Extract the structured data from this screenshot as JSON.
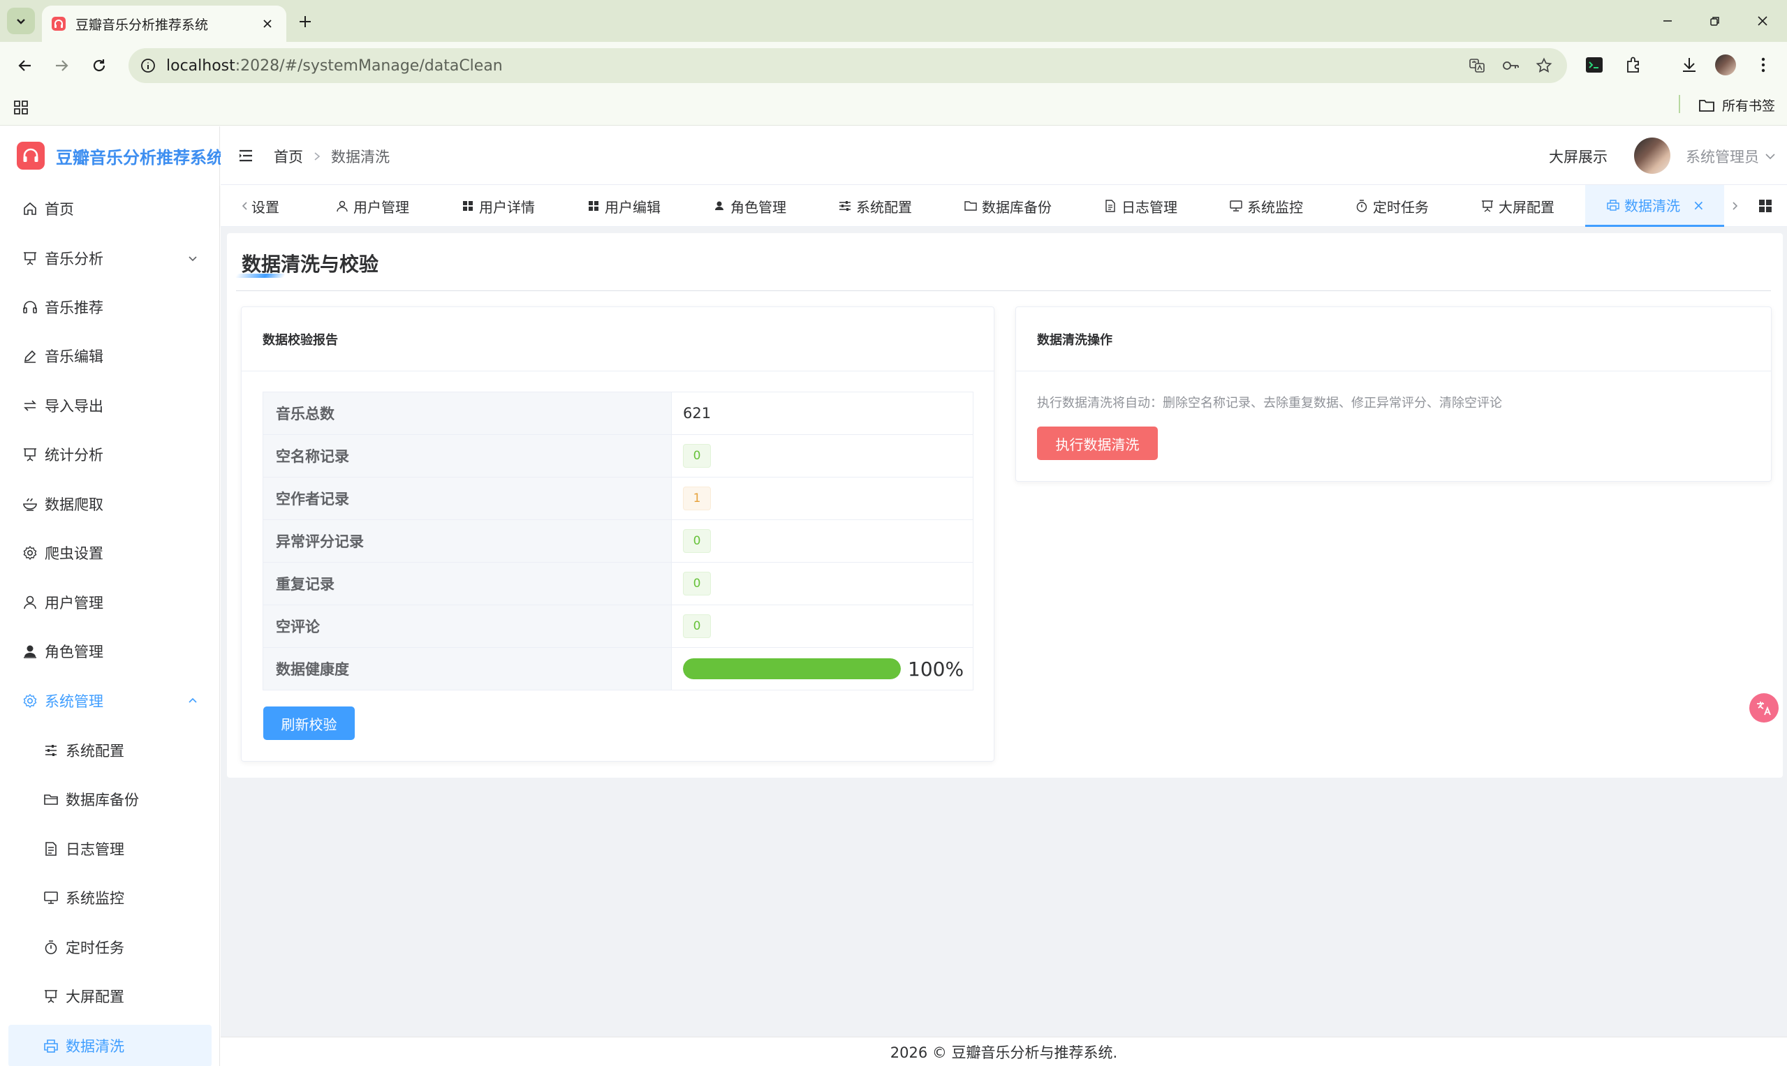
{
  "browser": {
    "tab_title": "豆瓣音乐分析推荐系统",
    "url_host": "localhost",
    "url_rest": ":2028/#/systemManage/dataClean",
    "bookmarks_all": "所有书签"
  },
  "sidebar": {
    "logo_text": "豆瓣音乐分析推荐系统",
    "items": [
      {
        "label": "首页",
        "icon": "home-icon"
      },
      {
        "label": "音乐分析",
        "icon": "presentation-icon"
      },
      {
        "label": "音乐推荐",
        "icon": "headphones-icon"
      },
      {
        "label": "音乐编辑",
        "icon": "edit-icon"
      },
      {
        "label": "导入导出",
        "icon": "swap-icon"
      },
      {
        "label": "统计分析",
        "icon": "presentation-icon"
      },
      {
        "label": "数据爬取",
        "icon": "bowl-icon"
      },
      {
        "label": "爬虫设置",
        "icon": "gear-icon"
      },
      {
        "label": "用户管理",
        "icon": "user-icon"
      },
      {
        "label": "角色管理",
        "icon": "person-icon"
      },
      {
        "label": "系统管理",
        "icon": "gear-icon"
      },
      {
        "label": "系统配置",
        "icon": "sliders-icon"
      },
      {
        "label": "数据库备份",
        "icon": "folder-icon"
      },
      {
        "label": "日志管理",
        "icon": "document-icon"
      },
      {
        "label": "系统监控",
        "icon": "monitor-icon"
      },
      {
        "label": "定时任务",
        "icon": "stopwatch-icon"
      },
      {
        "label": "大屏配置",
        "icon": "presentation-icon"
      },
      {
        "label": "数据清洗",
        "icon": "printer-icon"
      }
    ]
  },
  "header": {
    "breadcrumb_home": "首页",
    "breadcrumb_current": "数据清洗",
    "screen_link": "大屏展示",
    "user_name": "系统管理员"
  },
  "tags": [
    {
      "label": "设置",
      "icon": ""
    },
    {
      "label": "用户管理",
      "icon": "user-icon"
    },
    {
      "label": "用户详情",
      "icon": "grid-icon"
    },
    {
      "label": "用户编辑",
      "icon": "grid-icon"
    },
    {
      "label": "角色管理",
      "icon": "person-icon"
    },
    {
      "label": "系统配置",
      "icon": "sliders-icon"
    },
    {
      "label": "数据库备份",
      "icon": "folder-icon"
    },
    {
      "label": "日志管理",
      "icon": "document-icon"
    },
    {
      "label": "系统监控",
      "icon": "monitor-icon"
    },
    {
      "label": "定时任务",
      "icon": "stopwatch-icon"
    },
    {
      "label": "大屏配置",
      "icon": "presentation-icon"
    },
    {
      "label": "数据清洗",
      "icon": "printer-icon"
    }
  ],
  "page": {
    "title": "数据清洗与校验",
    "report": {
      "title": "数据校验报告",
      "rows": [
        {
          "label": "音乐总数",
          "value": "621"
        },
        {
          "label": "空名称记录",
          "value": "0"
        },
        {
          "label": "空作者记录",
          "value": "1"
        },
        {
          "label": "异常评分记录",
          "value": "0"
        },
        {
          "label": "重复记录",
          "value": "0"
        },
        {
          "label": "空评论",
          "value": "0"
        }
      ],
      "health_label": "数据健康度",
      "health_percent": 100,
      "health_text": "100%",
      "refresh_button": "刷新校验"
    },
    "clean": {
      "title": "数据清洗操作",
      "description": "执行数据清洗将自动：删除空名称记录、去除重复数据、修正异常评分、清除空评论",
      "execute_button": "执行数据清洗"
    }
  },
  "footer": {
    "text": "2026 © 豆瓣音乐分析与推荐系统."
  },
  "colors": {
    "primary": "#409eff",
    "danger": "#f56c6c",
    "success": "#67c23a",
    "warning": "#e6a23c",
    "logo_text": "#3d8ef0"
  }
}
